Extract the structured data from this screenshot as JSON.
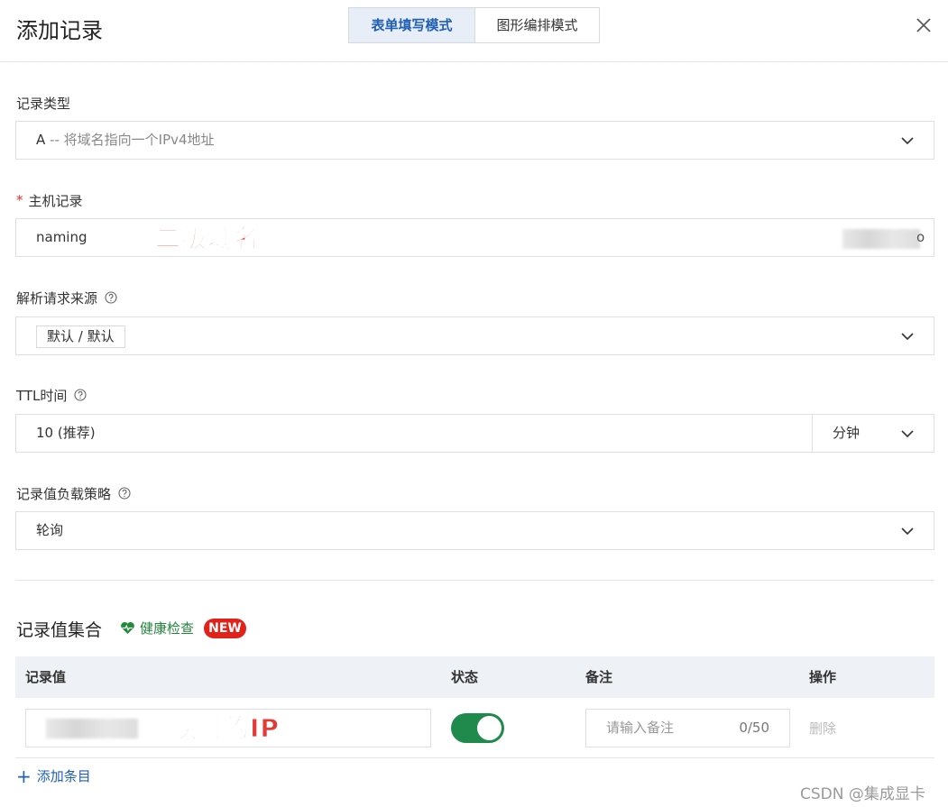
{
  "header": {
    "title": "添加记录",
    "tabs": [
      {
        "label": "表单填写模式",
        "active": true
      },
      {
        "label": "图形编排模式",
        "active": false
      }
    ]
  },
  "record_type": {
    "label": "记录类型",
    "value_prefix": "A",
    "value_desc": "-- 将域名指向一个IPv4地址"
  },
  "host_record": {
    "required_mark": "*",
    "label": "主机记录",
    "value": "naming",
    "suffix_tail": "o",
    "annotation": "二级域名"
  },
  "resolve_source": {
    "label": "解析请求来源",
    "tag": "默认 / 默认"
  },
  "ttl": {
    "label": "TTL时间",
    "value": "10 (推荐)",
    "unit": "分钟"
  },
  "load_strategy": {
    "label": "记录值负载策略",
    "value": "轮询"
  },
  "record_set": {
    "title": "记录值集合",
    "health_check": "健康检查",
    "new_badge": "NEW",
    "columns": [
      "记录值",
      "状态",
      "备注",
      "操作"
    ],
    "rows": [
      {
        "annotation": "映射的IP",
        "status_enabled": true,
        "note_placeholder": "请输入备注",
        "note_count": "0/50",
        "action": "删除"
      }
    ],
    "add_label": "添加条目"
  },
  "watermark": "CSDN @集成显卡",
  "colors": {
    "primary": "#1f5fb4",
    "toggle_on": "#1f8a4c",
    "health": "#21883c",
    "badge": "#e0221b",
    "annotation": "#e53935"
  }
}
